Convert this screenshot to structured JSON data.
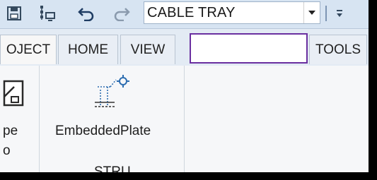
{
  "quick_access": {
    "icons": [
      "save-icon",
      "network-icon",
      "undo-icon",
      "redo-icon",
      "dropdown-caret-icon",
      "customize-icon"
    ],
    "style_selector": {
      "value": "CABLE TRAY"
    }
  },
  "tabs": [
    {
      "label": "OJECT"
    },
    {
      "label": "HOME"
    },
    {
      "label": "VIEW"
    },
    {
      "label": ""
    },
    {
      "label": "TOOLS"
    }
  ],
  "ribbon": {
    "left_item": {
      "label_line1": "pe",
      "label_line2": "o"
    },
    "embedded_plate": {
      "label": "EmbeddedPlate",
      "icon": "embedded-plate-icon"
    },
    "group_label": "STRU"
  },
  "colors": {
    "toolbar_bg": "#d7e4f2",
    "accent_outline": "#6a2fa0",
    "icon_blue": "#2b6cb0"
  }
}
